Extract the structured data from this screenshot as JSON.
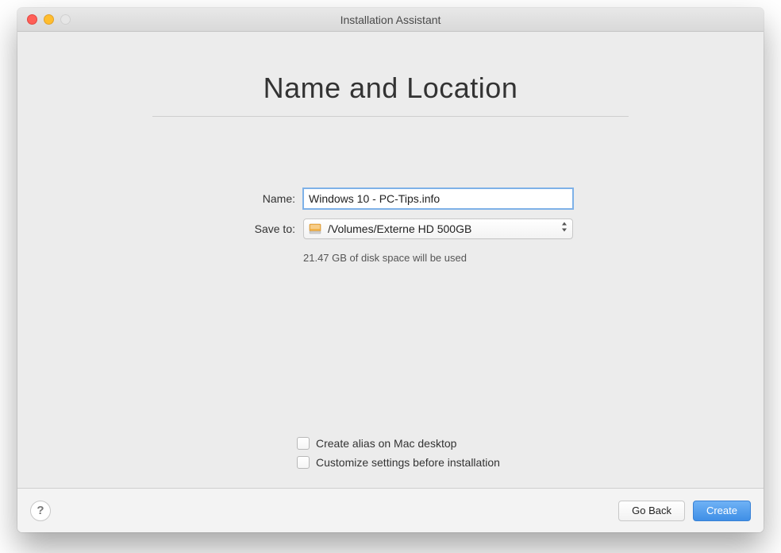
{
  "window": {
    "title": "Installation Assistant"
  },
  "page": {
    "heading": "Name and Location"
  },
  "form": {
    "name_label": "Name:",
    "name_value": "Windows 10 - PC-Tips.info",
    "saveto_label": "Save to:",
    "saveto_value": "/Volumes/Externe HD 500GB",
    "disk_info": "21.47 GB of disk space will be used"
  },
  "options": {
    "alias": {
      "checked": false,
      "label": "Create alias on Mac desktop"
    },
    "customize": {
      "checked": false,
      "label": "Customize settings before installation"
    }
  },
  "footer": {
    "help": "?",
    "back": "Go Back",
    "create": "Create"
  }
}
